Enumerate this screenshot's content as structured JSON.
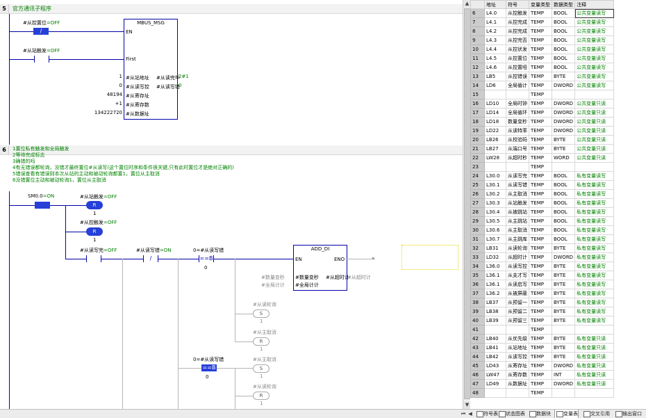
{
  "networks": {
    "n5": {
      "number": "5",
      "title": "官方通讯子程序"
    },
    "n6": {
      "number": "6",
      "comments": [
        "1置位私有触发和全局触发",
        "2等待完成标志",
        "3确错的吗",
        "4有无错误都轮询，没错才最终置位#从读写(这个置位时序和条件很关键,只有此时置位才是绝对正确的)",
        "5错误查看有错误则本次从站的主动和被动轮询都置1，置位从主取消",
        "6没错置位主动和被动轮询1，置位从主取消"
      ]
    }
  },
  "rung5": {
    "contact1": {
      "name": "#从控置位",
      "state": "=OFF",
      "symbol": "/"
    },
    "contact2": {
      "name": "#从站触发",
      "state": "=OFF"
    },
    "block": {
      "title": "MBUS_MSG",
      "pins_left": [
        "EN",
        "First",
        "#从站地址",
        "#从读写控",
        "#从寄存址",
        "#从寄存数",
        "#从数据址"
      ],
      "pins_right": [
        "#从读完毕",
        "#从读写错"
      ],
      "in_values": [
        "1",
        "0",
        "48194",
        "+1",
        "134222720"
      ],
      "out_values": [
        "2#1",
        "0"
      ]
    }
  },
  "rung6": {
    "sm0": {
      "name": "SM0.0",
      "state": "=ON"
    },
    "coil_r1": {
      "name": "#从站触发",
      "state": "=OFF",
      "text": "R",
      "value": "1"
    },
    "coil_r2": {
      "name": "#从控触发",
      "state": "=OFF",
      "text": "R",
      "value": "1"
    },
    "contact_read": {
      "name": "#从读写完",
      "state": "=OFF"
    },
    "contact_notreset": {
      "name": "#从读写错",
      "state": "=ON",
      "symbol": "/"
    },
    "compare1": {
      "name": "0=#从读写错",
      "op": "==B",
      "value": "0"
    },
    "add_di": {
      "title": "ADD_DI",
      "pins_left": [
        "EN",
        "#数量变秒",
        "#全局计计"
      ],
      "pins_right": [
        "ENO",
        "#从超时计"
      ],
      "in_labels": [
        "#数量变秒",
        "#全局计计"
      ],
      "out_label": "#从超时计"
    },
    "coil_s1": {
      "name": "#从读轮询",
      "text": "S",
      "value": "1"
    },
    "coil_r3": {
      "name": "#从主取消",
      "text": "R",
      "value": "1"
    },
    "compare2": {
      "name": "0=#从读写错",
      "op": "==B",
      "value": "0"
    },
    "coil_s2": {
      "name": "#从主取消",
      "text": "S",
      "value": "1"
    },
    "coil_r4": {
      "name": "#从读轮询",
      "text": "R",
      "value": "1"
    }
  },
  "var_table": {
    "headers": [
      "地址",
      "符号",
      "变量类型",
      "数据类型",
      "注释"
    ],
    "rows": [
      {
        "n": "6",
        "addr": "L4.0",
        "sym": "从控触发",
        "vt": "TEMP",
        "dt": "BOOL",
        "cm": "公共变量读写",
        "sel": true
      },
      {
        "n": "7",
        "addr": "L4.1",
        "sym": "从控完成",
        "vt": "TEMP",
        "dt": "BOOL",
        "cm": "公共变量读写"
      },
      {
        "n": "8",
        "addr": "L4.2",
        "sym": "从控完成",
        "vt": "TEMP",
        "dt": "BOOL",
        "cm": "公共变量读写"
      },
      {
        "n": "9",
        "addr": "L4.3",
        "sym": "从控完否",
        "vt": "TEMP",
        "dt": "BOOL",
        "cm": "公共变量读写"
      },
      {
        "n": "10",
        "addr": "L4.4",
        "sym": "从控状发",
        "vt": "TEMP",
        "dt": "BOOL",
        "cm": "公共变量读写"
      },
      {
        "n": "11",
        "addr": "L4.5",
        "sym": "从控置位",
        "vt": "TEMP",
        "dt": "BOOL",
        "cm": "公共变量读写"
      },
      {
        "n": "12",
        "addr": "L4.6",
        "sym": "从控置哑",
        "vt": "TEMP",
        "dt": "BOOL",
        "cm": "公共变量读写"
      },
      {
        "n": "13",
        "addr": "LB5",
        "sym": "从控错误",
        "vt": "TEMP",
        "dt": "BYTE",
        "cm": "公共变量读写"
      },
      {
        "n": "14",
        "addr": "LD6",
        "sym": "全局循计",
        "vt": "TEMP",
        "dt": "DWORD",
        "cm": "公共变量读写"
      },
      {
        "n": "15",
        "addr": "",
        "sym": "",
        "vt": "TEMP",
        "dt": "",
        "cm": ""
      },
      {
        "n": "16",
        "addr": "LD10",
        "sym": "全局时钟",
        "vt": "TEMP",
        "dt": "DWORD",
        "cm": "公共变量只读"
      },
      {
        "n": "17",
        "addr": "LD14",
        "sym": "全局循环",
        "vt": "TEMP",
        "dt": "DWORD",
        "cm": "公共变量只读"
      },
      {
        "n": "18",
        "addr": "LD18",
        "sym": "数量变秒",
        "vt": "TEMP",
        "dt": "DWORD",
        "cm": "公共变量只读"
      },
      {
        "n": "19",
        "addr": "LD22",
        "sym": "从读特率",
        "vt": "TEMP",
        "dt": "DWORD",
        "cm": "公共变量只读"
      },
      {
        "n": "20",
        "addr": "LB26",
        "sym": "从校验码",
        "vt": "TEMP",
        "dt": "BYTE",
        "cm": "公共变量只读"
      },
      {
        "n": "21",
        "addr": "LB27",
        "sym": "从端口号",
        "vt": "TEMP",
        "dt": "BYTE",
        "cm": "公共变量只读"
      },
      {
        "n": "22",
        "addr": "LW28",
        "sym": "从超时秒",
        "vt": "TEMP",
        "dt": "WORD",
        "cm": "公共变量只读"
      },
      {
        "n": "23",
        "addr": "",
        "sym": "",
        "vt": "TEMP",
        "dt": "",
        "cm": ""
      },
      {
        "n": "24",
        "addr": "L30.0",
        "sym": "从读写完",
        "vt": "TEMP",
        "dt": "BOOL",
        "cm": "私有变量读写"
      },
      {
        "n": "25",
        "addr": "L30.1",
        "sym": "从读写错",
        "vt": "TEMP",
        "dt": "BOOL",
        "cm": "私有变量读写"
      },
      {
        "n": "26",
        "addr": "L30.2",
        "sym": "从主取消",
        "vt": "TEMP",
        "dt": "BOOL",
        "cm": "私有变量读写"
      },
      {
        "n": "27",
        "addr": "L30.3",
        "sym": "从站触发",
        "vt": "TEMP",
        "dt": "BOOL",
        "cm": "私有变量读写"
      },
      {
        "n": "28",
        "addr": "L30.4",
        "sym": "从被跳站",
        "vt": "TEMP",
        "dt": "BOOL",
        "cm": "私有变量读写"
      },
      {
        "n": "29",
        "addr": "L30.5",
        "sym": "从主跳站",
        "vt": "TEMP",
        "dt": "BOOL",
        "cm": "私有变量读写"
      },
      {
        "n": "30",
        "addr": "L30.6",
        "sym": "从主取消",
        "vt": "TEMP",
        "dt": "BOOL",
        "cm": "私有变量读写"
      },
      {
        "n": "31",
        "addr": "L30.7",
        "sym": "从主跳库",
        "vt": "TEMP",
        "dt": "BOOL",
        "cm": "私有变量读写"
      },
      {
        "n": "32",
        "addr": "LB31",
        "sym": "从读轮询",
        "vt": "TEMP",
        "dt": "BYTE",
        "cm": "私有变量读写"
      },
      {
        "n": "33",
        "addr": "LD32",
        "sym": "从超时计",
        "vt": "TEMP",
        "dt": "DWORD",
        "cm": "私有变量读写"
      },
      {
        "n": "34",
        "addr": "L36.0",
        "sym": "从读写控",
        "vt": "TEMP",
        "dt": "BYTE",
        "cm": "私有变量读写"
      },
      {
        "n": "35",
        "addr": "L36.1",
        "sym": "从支才写",
        "vt": "TEMP",
        "dt": "BYTE",
        "cm": "私有变量读写"
      },
      {
        "n": "36",
        "addr": "L36.1",
        "sym": "从读启写",
        "vt": "TEMP",
        "dt": "BYTE",
        "cm": "私有变量读写"
      },
      {
        "n": "37",
        "addr": "L36.2",
        "sym": "从被屏蔽",
        "vt": "TEMP",
        "dt": "BYTE",
        "cm": "私有变量读写"
      },
      {
        "n": "38",
        "addr": "LB37",
        "sym": "从预留一",
        "vt": "TEMP",
        "dt": "BYTE",
        "cm": "私有变量读写"
      },
      {
        "n": "39",
        "addr": "LB38",
        "sym": "从预留二",
        "vt": "TEMP",
        "dt": "BYTE",
        "cm": "私有变量读写"
      },
      {
        "n": "40",
        "addr": "LB39",
        "sym": "从预留三",
        "vt": "TEMP",
        "dt": "BYTE",
        "cm": "私有变量读写"
      },
      {
        "n": "41",
        "addr": "",
        "sym": "",
        "vt": "TEMP",
        "dt": "",
        "cm": ""
      },
      {
        "n": "42",
        "addr": "LB40",
        "sym": "从优先级",
        "vt": "TEMP",
        "dt": "BYTE",
        "cm": "私有变量只读"
      },
      {
        "n": "43",
        "addr": "LB41",
        "sym": "从站地址",
        "vt": "TEMP",
        "dt": "BYTE",
        "cm": "私有变量只读"
      },
      {
        "n": "44",
        "addr": "LB42",
        "sym": "从读写控",
        "vt": "TEMP",
        "dt": "BYTE",
        "cm": "私有变量只读"
      },
      {
        "n": "45",
        "addr": "LD43",
        "sym": "从寄存址",
        "vt": "TEMP",
        "dt": "DWORD",
        "cm": "私有变量只读"
      },
      {
        "n": "46",
        "addr": "LW47",
        "sym": "从寄存数",
        "vt": "TEMP",
        "dt": "INT",
        "cm": "私有变量只读"
      },
      {
        "n": "47",
        "addr": "LD49",
        "sym": "从数据址",
        "vt": "TEMP",
        "dt": "DWORD",
        "cm": "私有变量只读"
      },
      {
        "n": "48",
        "addr": "",
        "sym": "",
        "vt": "TEMP",
        "dt": "",
        "cm": ""
      }
    ]
  },
  "bottom_tabs": [
    "符号表",
    "状态图表",
    "数据块",
    "变量表",
    "交叉引用",
    "输出窗口"
  ],
  "active_tab": "变量表",
  "colors": {
    "wire": "#0000aa",
    "contact_on": "#2640d8",
    "comment": "#008000",
    "row_number": "#cccccc"
  }
}
